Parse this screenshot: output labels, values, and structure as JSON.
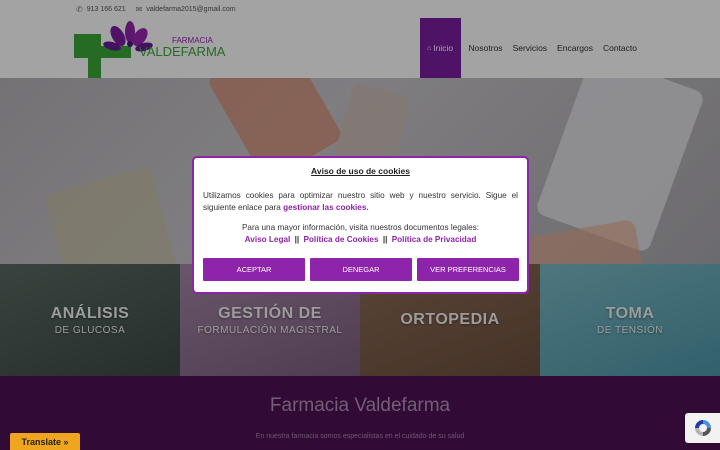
{
  "topbar": {
    "phone": "913 166 621",
    "email": "valdefarma2015@gmail.com"
  },
  "brand": {
    "line1": "FARMACIA",
    "line2": "VALDEFARMA",
    "green": "#3aa838",
    "purple": "#7b1fa2"
  },
  "nav": {
    "items": [
      {
        "label": "Inicio",
        "active": true,
        "icon": "home-icon"
      },
      {
        "label": "Nosotros"
      },
      {
        "label": "Servicios"
      },
      {
        "label": "Encargos"
      },
      {
        "label": "Contacto"
      }
    ]
  },
  "tiles": [
    {
      "line1": "ANÁLISIS",
      "line2": "DE GLUCOSA"
    },
    {
      "line1": "GESTIÓN DE",
      "line2": "FORMULACIÓN MAGISTRAL"
    },
    {
      "line1": "ORTOPEDIA",
      "line2": ""
    },
    {
      "line1": "TOMA",
      "line2": "DE TENSIÓN"
    }
  ],
  "about": {
    "title": "Farmacia Valdefarma",
    "subtitle": "En nuestra farmacia somos especialistas en el cuidado de su salud"
  },
  "cookies": {
    "title": "Aviso de uso de cookies",
    "desc_pre": "Utilizamos cookies para optimizar nuestro sitio web y nuestro servicio. Sigue el siguiente enlace para",
    "desc_link": "gestionar las cookies.",
    "legal_intro": "Para una mayor información, visita nuestros documentos legales:",
    "link_legal": "Aviso Legal",
    "link_cookies": "Política de Cookies",
    "link_privacy": "Política de Privacidad",
    "separator": "||",
    "btn_accept": "ACEPTAR",
    "btn_deny": "DENEGAR",
    "btn_prefs": "VER PREFERENCIAS",
    "accent": "#8e24aa"
  },
  "translate": {
    "label": "Translate »",
    "color": "#f0a51f"
  }
}
